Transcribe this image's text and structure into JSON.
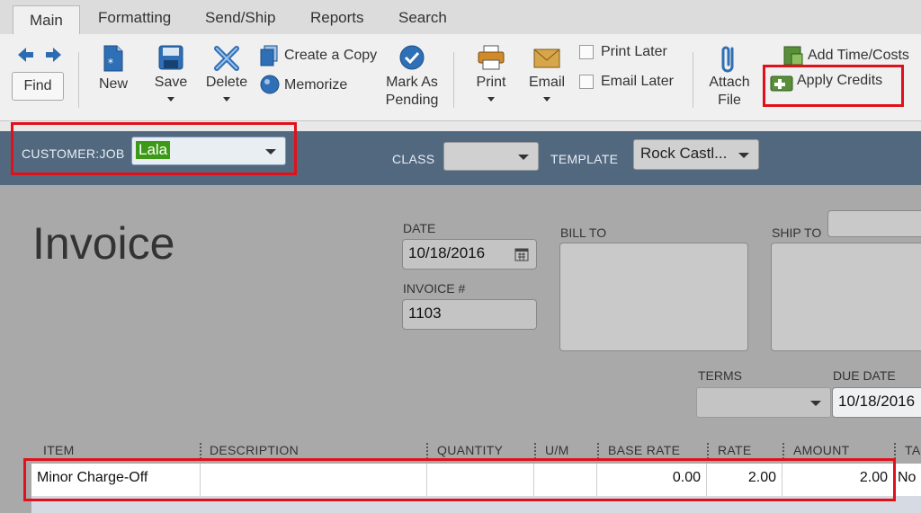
{
  "tabs": [
    {
      "label": "Main"
    },
    {
      "label": "Formatting"
    },
    {
      "label": "Send/Ship"
    },
    {
      "label": "Reports"
    },
    {
      "label": "Search"
    }
  ],
  "toolbar": {
    "find": "Find",
    "new": "New",
    "save": "Save",
    "delete": "Delete",
    "create_copy": "Create a Copy",
    "memorize": "Memorize",
    "mark_pending_1": "Mark As",
    "mark_pending_2": "Pending",
    "print": "Print",
    "email": "Email",
    "print_later": "Print Later",
    "email_later": "Email Later",
    "attach_1": "Attach",
    "attach_2": "File",
    "add_time_costs": "Add Time/Costs",
    "apply_credits": "Apply Credits"
  },
  "customer_bar": {
    "customer_job_label": "CUSTOMER:JOB",
    "customer_job_value": "Lala",
    "class_label": "CLASS",
    "class_value": "",
    "template_label": "TEMPLATE",
    "template_value": "Rock Castl..."
  },
  "form": {
    "title": "Invoice",
    "date_label": "DATE",
    "date_value": "10/18/2016",
    "invoice_no_label": "INVOICE #",
    "invoice_no_value": "1103",
    "bill_to_label": "BILL TO",
    "ship_to_label": "SHIP TO",
    "terms_label": "TERMS",
    "terms_value": "",
    "due_date_label": "DUE DATE",
    "due_date_value": "10/18/2016"
  },
  "table": {
    "columns": [
      "ITEM",
      "DESCRIPTION",
      "QUANTITY",
      "U/M",
      "BASE RATE",
      "RATE",
      "AMOUNT",
      "TA"
    ],
    "rows": [
      {
        "item": "Minor Charge-Off",
        "description": "",
        "quantity": "",
        "um": "",
        "base_rate": "0.00",
        "rate": "2.00",
        "amount": "2.00",
        "tax": "No"
      }
    ]
  },
  "colors": {
    "highlight": "#e0111b",
    "header_bar": "#52687f",
    "selected_text_bg": "#3c9a16"
  }
}
